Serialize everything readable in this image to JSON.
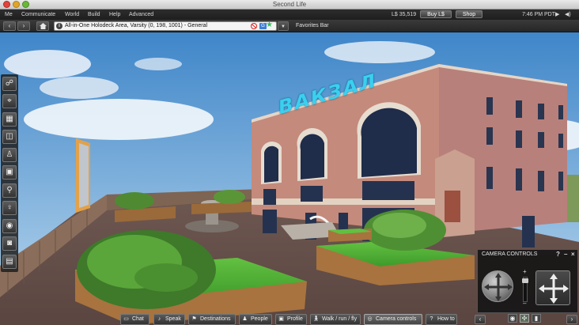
{
  "window": {
    "title": "Second Life"
  },
  "menubar": {
    "items": [
      "Me",
      "Communicate",
      "World",
      "Build",
      "Help",
      "Advanced"
    ],
    "balance": "L$ 35,519",
    "buy_label": "Buy L$",
    "shop_label": "Shop",
    "time": "7:46 PM PDT"
  },
  "navbar": {
    "location": "All-in-One Holodeck Area, Varsity (0, 198, 1001) - General",
    "maturity_badge": "G",
    "favorites_label": "Favorites Bar"
  },
  "scene": {
    "sign_text": "ВАКЗАЛ"
  },
  "left_toolbar": {
    "icons": [
      "gestures-icon",
      "pick-icon",
      "map-icon",
      "minimap-icon",
      "appearance-icon",
      "inventory-icon",
      "search-icon",
      "voice-icon",
      "nearby-voice-icon",
      "snapshot-icon",
      "notes-icon"
    ]
  },
  "bottom_toolbar": {
    "buttons": [
      "Chat",
      "Speak",
      "Destinations",
      "People",
      "Profile",
      "Walk / run / fly",
      "Camera controls",
      "How to"
    ],
    "active": "Camera controls"
  },
  "camera_controls": {
    "title": "CAMERA CONTROLS",
    "help": "?",
    "minimize": "–",
    "close": "×",
    "zoom_in": "+",
    "zoom_out": "–"
  },
  "colors": {
    "accent": "#3d7fd6",
    "sign": "#3ad0f0",
    "building": "#c48a7c",
    "sky_top": "#3f86c9"
  }
}
